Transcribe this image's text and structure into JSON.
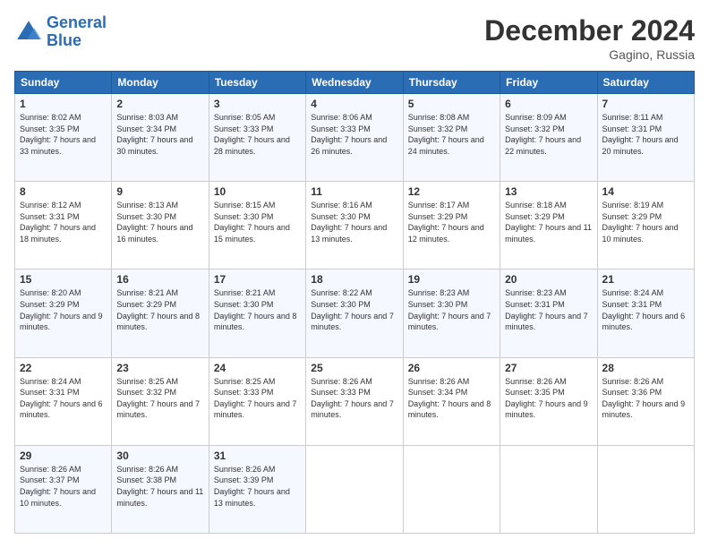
{
  "header": {
    "logo_line1": "General",
    "logo_line2": "Blue",
    "month_title": "December 2024",
    "location": "Gagino, Russia"
  },
  "days_of_week": [
    "Sunday",
    "Monday",
    "Tuesday",
    "Wednesday",
    "Thursday",
    "Friday",
    "Saturday"
  ],
  "weeks": [
    [
      {
        "day": "1",
        "sunrise": "8:02 AM",
        "sunset": "3:35 PM",
        "daylight": "7 hours and 33 minutes."
      },
      {
        "day": "2",
        "sunrise": "8:03 AM",
        "sunset": "3:34 PM",
        "daylight": "7 hours and 30 minutes."
      },
      {
        "day": "3",
        "sunrise": "8:05 AM",
        "sunset": "3:33 PM",
        "daylight": "7 hours and 28 minutes."
      },
      {
        "day": "4",
        "sunrise": "8:06 AM",
        "sunset": "3:33 PM",
        "daylight": "7 hours and 26 minutes."
      },
      {
        "day": "5",
        "sunrise": "8:08 AM",
        "sunset": "3:32 PM",
        "daylight": "7 hours and 24 minutes."
      },
      {
        "day": "6",
        "sunrise": "8:09 AM",
        "sunset": "3:32 PM",
        "daylight": "7 hours and 22 minutes."
      },
      {
        "day": "7",
        "sunrise": "8:11 AM",
        "sunset": "3:31 PM",
        "daylight": "7 hours and 20 minutes."
      }
    ],
    [
      {
        "day": "8",
        "sunrise": "8:12 AM",
        "sunset": "3:31 PM",
        "daylight": "7 hours and 18 minutes."
      },
      {
        "day": "9",
        "sunrise": "8:13 AM",
        "sunset": "3:30 PM",
        "daylight": "7 hours and 16 minutes."
      },
      {
        "day": "10",
        "sunrise": "8:15 AM",
        "sunset": "3:30 PM",
        "daylight": "7 hours and 15 minutes."
      },
      {
        "day": "11",
        "sunrise": "8:16 AM",
        "sunset": "3:30 PM",
        "daylight": "7 hours and 13 minutes."
      },
      {
        "day": "12",
        "sunrise": "8:17 AM",
        "sunset": "3:29 PM",
        "daylight": "7 hours and 12 minutes."
      },
      {
        "day": "13",
        "sunrise": "8:18 AM",
        "sunset": "3:29 PM",
        "daylight": "7 hours and 11 minutes."
      },
      {
        "day": "14",
        "sunrise": "8:19 AM",
        "sunset": "3:29 PM",
        "daylight": "7 hours and 10 minutes."
      }
    ],
    [
      {
        "day": "15",
        "sunrise": "8:20 AM",
        "sunset": "3:29 PM",
        "daylight": "7 hours and 9 minutes."
      },
      {
        "day": "16",
        "sunrise": "8:21 AM",
        "sunset": "3:29 PM",
        "daylight": "7 hours and 8 minutes."
      },
      {
        "day": "17",
        "sunrise": "8:21 AM",
        "sunset": "3:30 PM",
        "daylight": "7 hours and 8 minutes."
      },
      {
        "day": "18",
        "sunrise": "8:22 AM",
        "sunset": "3:30 PM",
        "daylight": "7 hours and 7 minutes."
      },
      {
        "day": "19",
        "sunrise": "8:23 AM",
        "sunset": "3:30 PM",
        "daylight": "7 hours and 7 minutes."
      },
      {
        "day": "20",
        "sunrise": "8:23 AM",
        "sunset": "3:31 PM",
        "daylight": "7 hours and 7 minutes."
      },
      {
        "day": "21",
        "sunrise": "8:24 AM",
        "sunset": "3:31 PM",
        "daylight": "7 hours and 6 minutes."
      }
    ],
    [
      {
        "day": "22",
        "sunrise": "8:24 AM",
        "sunset": "3:31 PM",
        "daylight": "7 hours and 6 minutes."
      },
      {
        "day": "23",
        "sunrise": "8:25 AM",
        "sunset": "3:32 PM",
        "daylight": "7 hours and 7 minutes."
      },
      {
        "day": "24",
        "sunrise": "8:25 AM",
        "sunset": "3:33 PM",
        "daylight": "7 hours and 7 minutes."
      },
      {
        "day": "25",
        "sunrise": "8:26 AM",
        "sunset": "3:33 PM",
        "daylight": "7 hours and 7 minutes."
      },
      {
        "day": "26",
        "sunrise": "8:26 AM",
        "sunset": "3:34 PM",
        "daylight": "7 hours and 8 minutes."
      },
      {
        "day": "27",
        "sunrise": "8:26 AM",
        "sunset": "3:35 PM",
        "daylight": "7 hours and 9 minutes."
      },
      {
        "day": "28",
        "sunrise": "8:26 AM",
        "sunset": "3:36 PM",
        "daylight": "7 hours and 9 minutes."
      }
    ],
    [
      {
        "day": "29",
        "sunrise": "8:26 AM",
        "sunset": "3:37 PM",
        "daylight": "7 hours and 10 minutes."
      },
      {
        "day": "30",
        "sunrise": "8:26 AM",
        "sunset": "3:38 PM",
        "daylight": "7 hours and 11 minutes."
      },
      {
        "day": "31",
        "sunrise": "8:26 AM",
        "sunset": "3:39 PM",
        "daylight": "7 hours and 13 minutes."
      },
      null,
      null,
      null,
      null
    ]
  ]
}
